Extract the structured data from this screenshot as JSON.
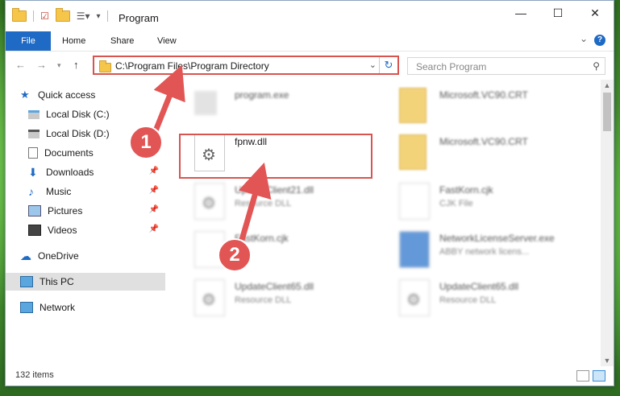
{
  "window": {
    "title": "Program",
    "controls": {
      "minimize": "—",
      "maximize": "☐",
      "close": "✕"
    }
  },
  "ribbon": {
    "tabs": [
      "File",
      "Home",
      "Share",
      "View"
    ],
    "help": "?"
  },
  "address_bar": {
    "path": "C:\\Program Files\\Program Directory",
    "search_placeholder": "Search Program"
  },
  "nav_pane": {
    "items": [
      {
        "label": "Quick access",
        "icon": "star-icon",
        "pinned": false
      },
      {
        "label": "Local Disk (C:)",
        "icon": "drive-icon",
        "pinned": false
      },
      {
        "label": "Local Disk (D:)",
        "icon": "drive-icon",
        "pinned": false
      },
      {
        "label": "Documents",
        "icon": "documents-icon",
        "pinned": true
      },
      {
        "label": "Downloads",
        "icon": "download-icon",
        "pinned": true
      },
      {
        "label": "Music",
        "icon": "music-icon",
        "pinned": true
      },
      {
        "label": "Pictures",
        "icon": "pictures-icon",
        "pinned": true
      },
      {
        "label": "Videos",
        "icon": "videos-icon",
        "pinned": true
      },
      {
        "label": "OneDrive",
        "icon": "cloud-icon",
        "pinned": false
      },
      {
        "label": "This PC",
        "icon": "computer-icon",
        "pinned": false,
        "selected": true
      },
      {
        "label": "Network",
        "icon": "network-icon",
        "pinned": false
      }
    ]
  },
  "files": [
    {
      "name": "program.exe",
      "type": ""
    },
    {
      "name": "Microsoft.VC90.CRT",
      "type": ""
    },
    {
      "name": "fpnw.dll",
      "type": ""
    },
    {
      "name": "Microsoft.VC90.CRT",
      "type": ""
    },
    {
      "name": "UpdateClient21.dll",
      "type": "Resource DLL"
    },
    {
      "name": "FastKorn.cjk",
      "type": "CJK File"
    },
    {
      "name": "FastKorn.cjk",
      "type": ""
    },
    {
      "name": "NetworkLicenseServer.exe",
      "type": "ABBY network licens..."
    },
    {
      "name": "UpdateClient65.dll",
      "type": "Resource DLL"
    },
    {
      "name": "UpdateClient65.dll",
      "type": "Resource DLL"
    }
  ],
  "status": {
    "count": "132 items"
  },
  "annotations": {
    "step1": "1",
    "step2": "2"
  },
  "colors": {
    "accent": "#1f6ac4",
    "highlight": "#d9534f"
  }
}
